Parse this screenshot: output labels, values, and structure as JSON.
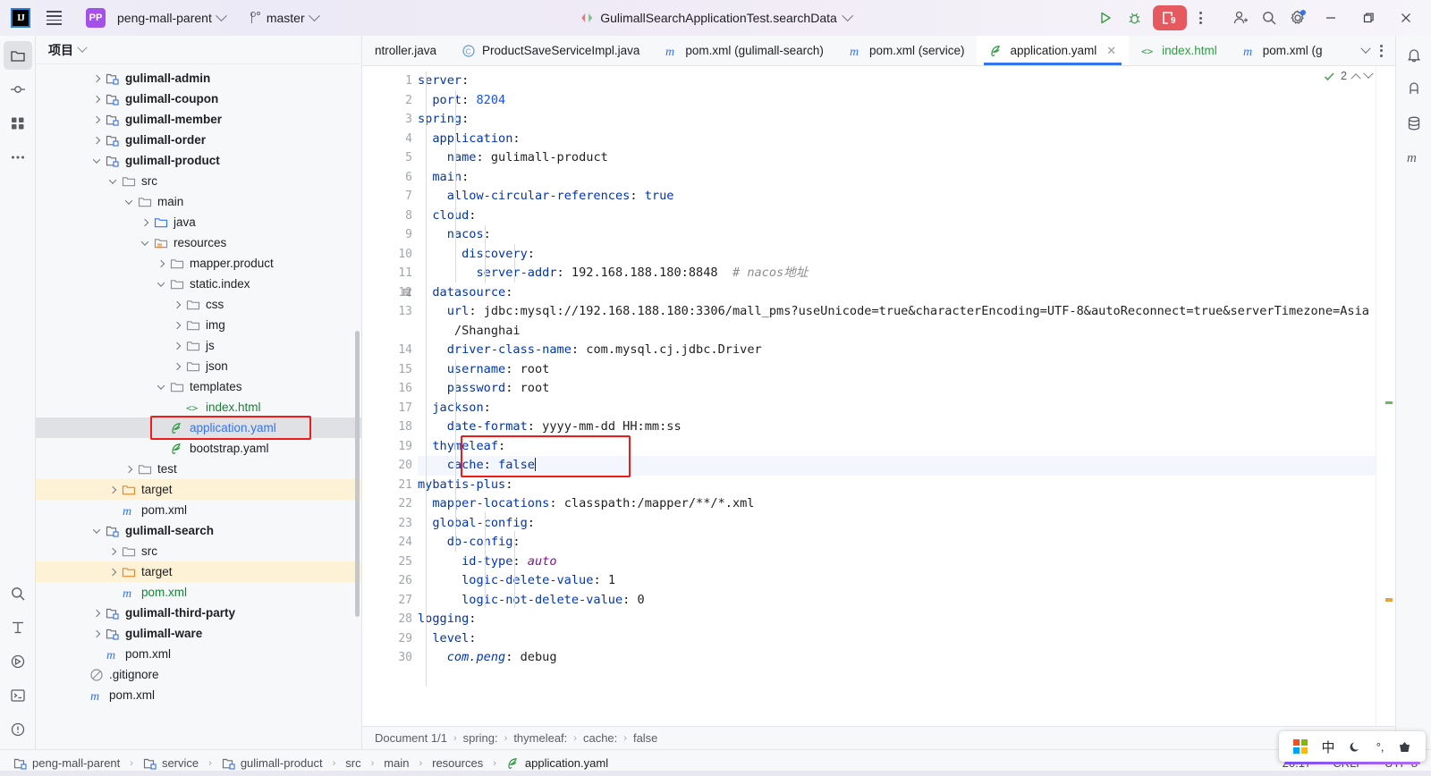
{
  "titlebar": {
    "logo_text": "IJ",
    "project_chip": "PP",
    "project_name": "peng-mall-parent",
    "branch_name": "master",
    "run_config": "GulimallSearchApplicationTest.searchData",
    "run_badge_count": "9",
    "icons": {
      "menu": "hamburger-icon",
      "run": "run-icon",
      "debug": "debug-icon",
      "more": "more-options-icon",
      "share": "add-user-icon",
      "search": "search-icon",
      "settings": "settings-gear-icon",
      "minimize": "minimize-icon",
      "maximize": "maximize-icon",
      "close": "close-icon"
    }
  },
  "project_panel": {
    "header_title": "项目",
    "tree": [
      {
        "label": "gulimall-admin",
        "indent": 1,
        "arrow": "right",
        "icon": "module",
        "style": "bold",
        "color": "plain"
      },
      {
        "label": "gulimall-coupon",
        "indent": 1,
        "arrow": "right",
        "icon": "module",
        "style": "bold",
        "color": "plain"
      },
      {
        "label": "gulimall-member",
        "indent": 1,
        "arrow": "right",
        "icon": "module",
        "style": "bold",
        "color": "plain"
      },
      {
        "label": "gulimall-order",
        "indent": 1,
        "arrow": "right",
        "icon": "module",
        "style": "bold",
        "color": "plain"
      },
      {
        "label": "gulimall-product",
        "indent": 1,
        "arrow": "down",
        "icon": "module",
        "style": "bold",
        "color": "plain"
      },
      {
        "label": "src",
        "indent": 2,
        "arrow": "down",
        "icon": "folder",
        "style": "",
        "color": "plain"
      },
      {
        "label": "main",
        "indent": 3,
        "arrow": "down",
        "icon": "folder",
        "style": "",
        "color": "plain"
      },
      {
        "label": "java",
        "indent": 4,
        "arrow": "right",
        "icon": "srcfolder",
        "style": "",
        "color": "plain"
      },
      {
        "label": "resources",
        "indent": 4,
        "arrow": "down",
        "icon": "resfolder",
        "style": "",
        "color": "plain"
      },
      {
        "label": "mapper.product",
        "indent": 5,
        "arrow": "right",
        "icon": "folder",
        "style": "",
        "color": "plain"
      },
      {
        "label": "static.index",
        "indent": 5,
        "arrow": "down",
        "icon": "folder",
        "style": "",
        "color": "plain"
      },
      {
        "label": "css",
        "indent": 6,
        "arrow": "right",
        "icon": "folder",
        "style": "",
        "color": "plain"
      },
      {
        "label": "img",
        "indent": 6,
        "arrow": "right",
        "icon": "folder",
        "style": "",
        "color": "plain"
      },
      {
        "label": "js",
        "indent": 6,
        "arrow": "right",
        "icon": "folder",
        "style": "",
        "color": "plain"
      },
      {
        "label": "json",
        "indent": 6,
        "arrow": "right",
        "icon": "folder",
        "style": "",
        "color": "plain"
      },
      {
        "label": "templates",
        "indent": 5,
        "arrow": "down",
        "icon": "folder",
        "style": "",
        "color": "plain"
      },
      {
        "label": "index.html",
        "indent": 6,
        "arrow": "none",
        "icon": "html",
        "style": "",
        "color": "green"
      },
      {
        "label": "application.yaml",
        "indent": 5,
        "arrow": "none",
        "icon": "yaml",
        "style": "",
        "color": "blue",
        "state": "selected"
      },
      {
        "label": "bootstrap.yaml",
        "indent": 5,
        "arrow": "none",
        "icon": "yaml",
        "style": "",
        "color": "plain"
      },
      {
        "label": "test",
        "indent": 3,
        "arrow": "right",
        "icon": "folder",
        "style": "",
        "color": "plain"
      },
      {
        "label": "target",
        "indent": 2,
        "arrow": "right",
        "icon": "target",
        "style": "",
        "color": "plain",
        "state": "highlight"
      },
      {
        "label": "pom.xml",
        "indent": 2,
        "arrow": "none",
        "icon": "maven",
        "style": "",
        "color": "plain"
      },
      {
        "label": "gulimall-search",
        "indent": 1,
        "arrow": "down",
        "icon": "module",
        "style": "bold",
        "color": "plain"
      },
      {
        "label": "src",
        "indent": 2,
        "arrow": "right",
        "icon": "folder",
        "style": "",
        "color": "plain"
      },
      {
        "label": "target",
        "indent": 2,
        "arrow": "right",
        "icon": "target",
        "style": "",
        "color": "plain",
        "state": "highlight"
      },
      {
        "label": "pom.xml",
        "indent": 2,
        "arrow": "none",
        "icon": "maven",
        "style": "",
        "color": "green"
      },
      {
        "label": "gulimall-third-party",
        "indent": 1,
        "arrow": "right",
        "icon": "module",
        "style": "bold",
        "color": "plain"
      },
      {
        "label": "gulimall-ware",
        "indent": 1,
        "arrow": "right",
        "icon": "module",
        "style": "bold",
        "color": "plain"
      },
      {
        "label": "pom.xml",
        "indent": 1,
        "arrow": "none",
        "icon": "maven",
        "style": "",
        "color": "plain"
      },
      {
        "label": ".gitignore",
        "indent": 0,
        "arrow": "none",
        "icon": "gitignore",
        "style": "",
        "color": "plain"
      },
      {
        "label": "pom.xml",
        "indent": 0,
        "arrow": "none",
        "icon": "maven",
        "style": "",
        "color": "plain"
      }
    ]
  },
  "editor_tabs": [
    {
      "label": "ntroller.java",
      "icon": "none",
      "active": false,
      "truncated": true
    },
    {
      "label": "ProductSaveServiceImpl.java",
      "icon": "class",
      "active": false
    },
    {
      "label": "pom.xml (gulimall-search)",
      "icon": "maven",
      "active": false
    },
    {
      "label": "pom.xml (service)",
      "icon": "maven",
      "active": false
    },
    {
      "label": "application.yaml",
      "icon": "yaml",
      "active": true,
      "closable": true
    },
    {
      "label": "index.html",
      "icon": "html",
      "active": false
    },
    {
      "label": "pom.xml (g",
      "icon": "maven",
      "active": false,
      "truncated": true
    }
  ],
  "editor": {
    "inspection_count": "2",
    "lines": [
      {
        "n": "1",
        "indent": 0,
        "tokens": [
          {
            "t": "server",
            "c": "kw"
          },
          {
            "t": ":",
            "c": "val"
          }
        ]
      },
      {
        "n": "2",
        "indent": 1,
        "tokens": [
          {
            "t": "port",
            "c": "kw"
          },
          {
            "t": ": ",
            "c": "val"
          },
          {
            "t": "8204",
            "c": "num"
          }
        ]
      },
      {
        "n": "3",
        "indent": 0,
        "tokens": [
          {
            "t": "spring",
            "c": "kw"
          },
          {
            "t": ":",
            "c": "val"
          }
        ]
      },
      {
        "n": "4",
        "indent": 1,
        "tokens": [
          {
            "t": "application",
            "c": "kw"
          },
          {
            "t": ":",
            "c": "val"
          }
        ]
      },
      {
        "n": "5",
        "indent": 2,
        "tokens": [
          {
            "t": "name",
            "c": "kw"
          },
          {
            "t": ": ",
            "c": "val"
          },
          {
            "t": "gulimall-product",
            "c": "val"
          }
        ]
      },
      {
        "n": "6",
        "indent": 1,
        "tokens": [
          {
            "t": "main",
            "c": "kw"
          },
          {
            "t": ":",
            "c": "val"
          }
        ]
      },
      {
        "n": "7",
        "indent": 2,
        "tokens": [
          {
            "t": "allow-circular-references",
            "c": "kw"
          },
          {
            "t": ": ",
            "c": "val"
          },
          {
            "t": "true",
            "c": "bool"
          }
        ]
      },
      {
        "n": "8",
        "indent": 1,
        "tokens": [
          {
            "t": "cloud",
            "c": "kw"
          },
          {
            "t": ":",
            "c": "val"
          }
        ]
      },
      {
        "n": "9",
        "indent": 2,
        "tokens": [
          {
            "t": "nacos",
            "c": "kw"
          },
          {
            "t": ":",
            "c": "val"
          }
        ]
      },
      {
        "n": "10",
        "indent": 3,
        "tokens": [
          {
            "t": "discovery",
            "c": "kw"
          },
          {
            "t": ":",
            "c": "val"
          }
        ]
      },
      {
        "n": "11",
        "indent": 4,
        "tokens": [
          {
            "t": "server-addr",
            "c": "kw"
          },
          {
            "t": ": ",
            "c": "val"
          },
          {
            "t": "192.168.188.180:8848",
            "c": "val"
          },
          {
            "t": "  # nacos地址",
            "c": "cmt"
          }
        ]
      },
      {
        "n": "12",
        "indent": 1,
        "tokens": [
          {
            "t": "datasource",
            "c": "kw"
          },
          {
            "t": ":",
            "c": "val"
          }
        ],
        "gutter_icon": "database-icon"
      },
      {
        "n": "13",
        "indent": 2,
        "tokens": [
          {
            "t": "url",
            "c": "kw"
          },
          {
            "t": ": ",
            "c": "val"
          },
          {
            "t": "jdbc:mysql://192.168.188.180:3306/mall_pms?useUnicode=true&characterEncoding=UTF-8&autoReconnect=true&serverTimezone=Asia",
            "c": "val"
          }
        ]
      },
      {
        "n": "",
        "indent": 2,
        "tokens": [
          {
            "t": " /Shanghai",
            "c": "val"
          }
        ],
        "wrapped": true
      },
      {
        "n": "14",
        "indent": 2,
        "tokens": [
          {
            "t": "driver-class-name",
            "c": "kw"
          },
          {
            "t": ": ",
            "c": "val"
          },
          {
            "t": "com.mysql.cj.jdbc.Driver",
            "c": "val"
          }
        ]
      },
      {
        "n": "15",
        "indent": 2,
        "tokens": [
          {
            "t": "username",
            "c": "kw"
          },
          {
            "t": ": ",
            "c": "val"
          },
          {
            "t": "root",
            "c": "val"
          }
        ]
      },
      {
        "n": "16",
        "indent": 2,
        "tokens": [
          {
            "t": "password",
            "c": "kw"
          },
          {
            "t": ": ",
            "c": "val"
          },
          {
            "t": "root",
            "c": "val"
          }
        ]
      },
      {
        "n": "17",
        "indent": 1,
        "tokens": [
          {
            "t": "jackson",
            "c": "kw"
          },
          {
            "t": ":",
            "c": "val"
          }
        ]
      },
      {
        "n": "18",
        "indent": 2,
        "tokens": [
          {
            "t": "date-format",
            "c": "kw"
          },
          {
            "t": ": ",
            "c": "val"
          },
          {
            "t": "yyyy-mm-dd HH:mm:ss",
            "c": "val"
          }
        ]
      },
      {
        "n": "19",
        "indent": 1,
        "tokens": [
          {
            "t": "thymeleaf",
            "c": "kw"
          },
          {
            "t": ":",
            "c": "val"
          }
        ],
        "changed": true
      },
      {
        "n": "20",
        "indent": 2,
        "tokens": [
          {
            "t": "cache",
            "c": "kw"
          },
          {
            "t": ": ",
            "c": "val"
          },
          {
            "t": "false",
            "c": "bool"
          }
        ],
        "changed": true,
        "current": true,
        "caret": true
      },
      {
        "n": "21",
        "indent": 0,
        "tokens": [
          {
            "t": "mybatis-plus",
            "c": "kw"
          },
          {
            "t": ":",
            "c": "val"
          }
        ]
      },
      {
        "n": "22",
        "indent": 1,
        "tokens": [
          {
            "t": "mapper-locations",
            "c": "kw"
          },
          {
            "t": ": ",
            "c": "val"
          },
          {
            "t": "classpath:/mapper/**/*.xml",
            "c": "val"
          }
        ]
      },
      {
        "n": "23",
        "indent": 1,
        "tokens": [
          {
            "t": "global-config",
            "c": "kw"
          },
          {
            "t": ":",
            "c": "val"
          }
        ]
      },
      {
        "n": "24",
        "indent": 2,
        "tokens": [
          {
            "t": "db-config",
            "c": "kw"
          },
          {
            "t": ":",
            "c": "val"
          }
        ]
      },
      {
        "n": "25",
        "indent": 3,
        "tokens": [
          {
            "t": "id-type",
            "c": "kw"
          },
          {
            "t": ": ",
            "c": "val"
          },
          {
            "t": "auto",
            "c": "ital"
          }
        ]
      },
      {
        "n": "26",
        "indent": 3,
        "tokens": [
          {
            "t": "logic-delete-value",
            "c": "kw"
          },
          {
            "t": ": ",
            "c": "val"
          },
          {
            "t": "1",
            "c": "val"
          }
        ]
      },
      {
        "n": "27",
        "indent": 3,
        "tokens": [
          {
            "t": "logic-not-delete-value",
            "c": "kw"
          },
          {
            "t": ": ",
            "c": "val"
          },
          {
            "t": "0",
            "c": "val"
          }
        ]
      },
      {
        "n": "28",
        "indent": 0,
        "tokens": [
          {
            "t": "logging",
            "c": "kw"
          },
          {
            "t": ":",
            "c": "val"
          }
        ]
      },
      {
        "n": "29",
        "indent": 1,
        "tokens": [
          {
            "t": "level",
            "c": "kw"
          },
          {
            "t": ":",
            "c": "val"
          }
        ]
      },
      {
        "n": "30",
        "indent": 2,
        "tokens": [
          {
            "t": "com.peng",
            "c": "italg"
          },
          {
            "t": ": ",
            "c": "val"
          },
          {
            "t": "debug",
            "c": "val"
          }
        ]
      }
    ]
  },
  "editor_breadcrumb": [
    "Document 1/1",
    "spring:",
    "thymeleaf:",
    "cache:",
    "false"
  ],
  "status_breadcrumb": [
    {
      "label": "peng-mall-parent",
      "icon": "module"
    },
    {
      "label": "service",
      "icon": "module"
    },
    {
      "label": "gulimall-product",
      "icon": "module"
    },
    {
      "label": "src",
      "icon": "none"
    },
    {
      "label": "main",
      "icon": "none"
    },
    {
      "label": "resources",
      "icon": "none"
    },
    {
      "label": "application.yaml",
      "icon": "yaml"
    }
  ],
  "status_right": {
    "caret_position": "20:17",
    "line_separator": "CRLF",
    "encoding": "UTF-8"
  },
  "ime_bar": {
    "windows_icon": "windows-logo-icon",
    "mode": "中",
    "moon": "moon-icon",
    "punct": "°,",
    "tools": "toolbox-icon"
  },
  "left_rail": [
    "project-icon",
    "commit-icon",
    "structure-icon",
    "more-tools-icon",
    "search-everywhere-icon",
    "terminal-icon",
    "services-icon",
    "problems-icon"
  ],
  "right_rail": [
    "notifications-icon",
    "ai-assistant-icon",
    "database-icon",
    "maven-icon"
  ],
  "colors": {
    "accent": "#3574f0",
    "highlight_box": "#ee1b1b",
    "target_row": "#fdf2d6",
    "run_badge": "#e5595f"
  }
}
